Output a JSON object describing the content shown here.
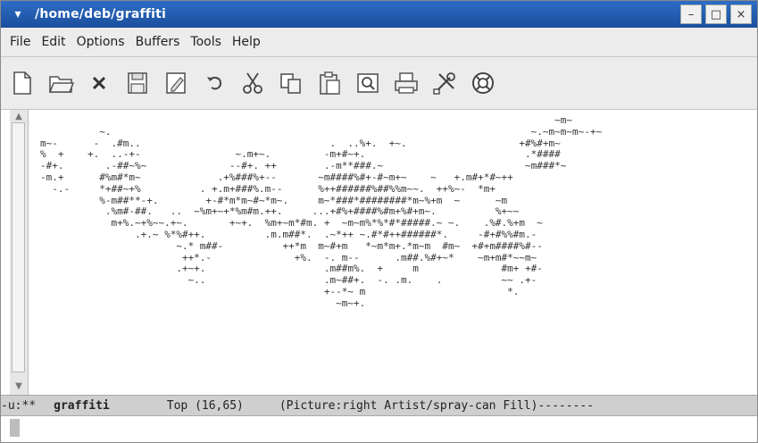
{
  "window": {
    "title": "/home/deb/graffiti",
    "minimize_symbol": "–",
    "maximize_symbol": "□",
    "close_symbol": "×",
    "menu_symbol": "▾"
  },
  "menubar": {
    "items": [
      "File",
      "Edit",
      "Options",
      "Buffers",
      "Tools",
      "Help"
    ]
  },
  "toolbar": {
    "icons": [
      "new-file-icon",
      "open-folder-icon",
      "close-icon",
      "save-icon",
      "save-as-icon",
      "undo-icon",
      "cut-icon",
      "copy-icon",
      "paste-icon",
      "search-icon",
      "print-icon",
      "customize-icon",
      "help-lifebuoy-icon"
    ]
  },
  "editor": {
    "art_lines": [
      "                                                                                       ~m~",
      "          ~.                                                                       ~.~m~m~m~-+~",
      "m~-      -  .#m..                                .  ..%+.  +~.                   +#%#+m~",
      "%  +    +.  ..-+-                ~.m+~.         -m+#~+.                           .*####",
      "-#+.       .-##~%~              --#+. ++        .-m**###.~                        ~m###*~",
      "-m.+      #%m#*m~             .+%###%+--       ~m####%#+-#~m+~    ~   +.m#+*#~++",
      "  -.-     *+##~+%          . +.m+###%.m--      %++######%##%%m~~.  ++%~-  *m+",
      "          %-m##**-+.        +-#*m*m~#~*m~.     m~*###*########*m~%+m  ~      ~m",
      "           .%m#-##.   ..  ~%m+~+*%m#m.++.     ...+#%+####%#m+%#+m~.          %+~~",
      "            m+%.~+%~~.+~.       +~+.  %m+~m*#m. +  ~m~m%*%*#*#####.~ ~.    .%#.%+m  ~",
      "                .+.~ %*%#++.          .m.m##*.  .~*++ ~.#*#++######*.     -#+#%%#m.-",
      "                       ~.* m##-          ++*m  m~#+m   *~m*m+.*m~m  #m~  +#+m####%#--",
      "                        ++*.-              +%.  -. m--      .m##.%#+~*    ~m+m#*~~m~",
      "                       .+~+.                    .m##m%.  +     m              #m+ +#-",
      "                         ~..                    .m~##+.  -. .m.    .          ~~ .+-",
      "                                                +--*~ m                        *.",
      "                                                  ~m~+."
    ]
  },
  "modeline": {
    "status": "-u:**",
    "buffer": "graffiti",
    "position": "Top (16,65)",
    "mode": "(Picture:right Artist/spray-can Fill)--------"
  }
}
